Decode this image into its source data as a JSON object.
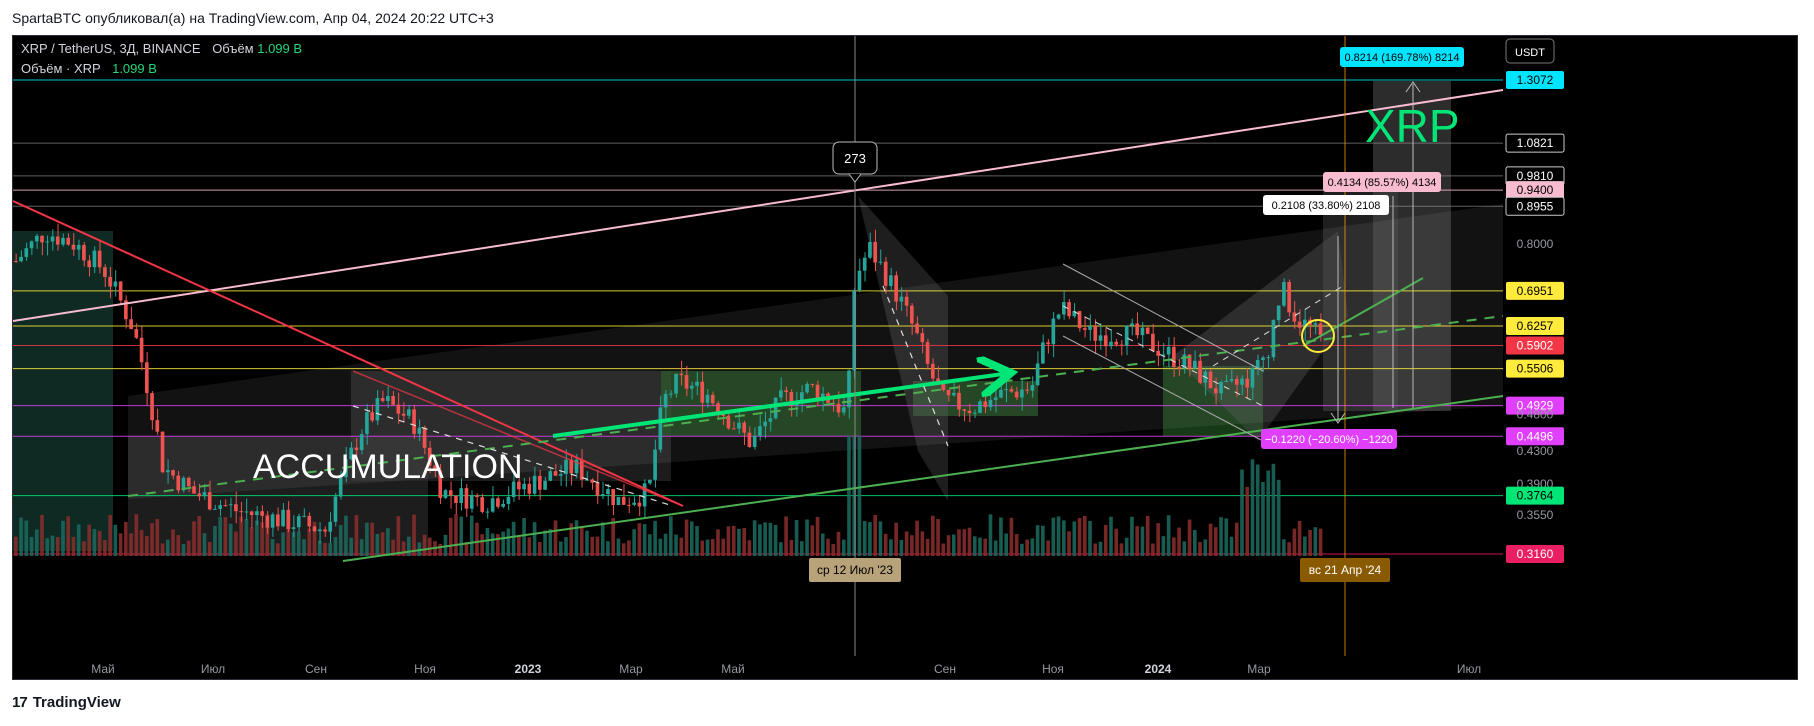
{
  "header": {
    "text": "SpartaBTC опубликовал(а) на TradingView.com, Апр 04, 2024 20:22 UTC+3"
  },
  "legend": {
    "line1_prefix": "XRP / TetherUS, 3Д, BINANCE",
    "line1_vol_label": "Объём",
    "line1_vol_value": "1.099 B",
    "line2_label": "Объём · XRP",
    "line2_value": "1.099 B"
  },
  "currency_button": "USDT",
  "footer": {
    "logo_mark": "17",
    "logo_text": "TradingView"
  },
  "annotations": {
    "accumulation": "ACCUMULATION",
    "xrp_big": "XRP",
    "peak_label": "273",
    "measure_top": "0.8214 (169.78%) 8214",
    "measure_mid": "0.4134 (85.57%) 4134",
    "measure_left": "0.2108 (33.80%) 2108",
    "measure_down": "−0.1220 (−20.60%) −1220",
    "crosshair_date": "ср 12 Июл '23",
    "current_date": "вс 21 Апр '24"
  },
  "colors": {
    "background": "#000000",
    "up": "#26a69a",
    "down": "#ef5350",
    "green_line": "#4caf50",
    "bright_green": "#00e676",
    "red_line": "#f23645",
    "pink_line": "#f8bbd0",
    "yellow": "#ffeb3b",
    "magenta": "#e040fb",
    "cyan": "#00bcd4"
  },
  "chart_data": {
    "type": "candlestick",
    "title": "XRP / TetherUS, 3Д, BINANCE",
    "xlabel": "",
    "ylabel": "",
    "y_scale": "log",
    "ylim": [
      0.316,
      1.3072
    ],
    "x_ticks": [
      "Май",
      "Июл",
      "Сен",
      "Ноя",
      "2023",
      "Мар",
      "Май",
      "Сен",
      "Ноя",
      "2024",
      "Мар",
      "Июл"
    ],
    "price_levels": [
      {
        "value": "1.3072",
        "style": "highlight",
        "color": "#00e5ff"
      },
      {
        "value": "1.0821",
        "style": "box"
      },
      {
        "value": "0.9810",
        "style": "box"
      },
      {
        "value": "0.9400",
        "style": "highlight",
        "color": "#f8bbd0"
      },
      {
        "value": "0.8955",
        "style": "box"
      },
      {
        "value": "0.8000",
        "style": "plain"
      },
      {
        "value": "0.6951",
        "style": "highlight",
        "color": "#ffeb3b"
      },
      {
        "value": "0.6257",
        "style": "highlight",
        "color": "#ffeb3b"
      },
      {
        "value": "0.5902",
        "style": "highlight",
        "color": "#f23645"
      },
      {
        "value": "0.5506",
        "style": "highlight",
        "color": "#ffeb3b"
      },
      {
        "value": "0.4929",
        "style": "highlight",
        "color": "#e040fb"
      },
      {
        "value": "0.4800",
        "style": "plain"
      },
      {
        "value": "0.4496",
        "style": "highlight",
        "color": "#e040fb"
      },
      {
        "value": "0.4300",
        "style": "plain"
      },
      {
        "value": "0.3900",
        "style": "plain"
      },
      {
        "value": "0.3764",
        "style": "highlight",
        "color": "#00e676"
      },
      {
        "value": "0.3550",
        "style": "plain"
      },
      {
        "value": "0.3160",
        "style": "highlight",
        "color": "#e91e63"
      }
    ],
    "price_path": [
      [
        0.0,
        0.76
      ],
      [
        0.02,
        0.83
      ],
      [
        0.04,
        0.8
      ],
      [
        0.06,
        0.74
      ],
      [
        0.08,
        0.62
      ],
      [
        0.1,
        0.41
      ],
      [
        0.12,
        0.38
      ],
      [
        0.15,
        0.36
      ],
      [
        0.18,
        0.35
      ],
      [
        0.21,
        0.34
      ],
      [
        0.235,
        0.46
      ],
      [
        0.25,
        0.5
      ],
      [
        0.27,
        0.47
      ],
      [
        0.29,
        0.38
      ],
      [
        0.32,
        0.37
      ],
      [
        0.35,
        0.39
      ],
      [
        0.38,
        0.41
      ],
      [
        0.41,
        0.37
      ],
      [
        0.43,
        0.38
      ],
      [
        0.44,
        0.5
      ],
      [
        0.45,
        0.53
      ],
      [
        0.47,
        0.51
      ],
      [
        0.49,
        0.46
      ],
      [
        0.5,
        0.44
      ],
      [
        0.52,
        0.5
      ],
      [
        0.54,
        0.52
      ],
      [
        0.555,
        0.5
      ],
      [
        0.565,
        0.48
      ],
      [
        0.57,
        0.72
      ],
      [
        0.58,
        0.79
      ],
      [
        0.6,
        0.68
      ],
      [
        0.61,
        0.62
      ],
      [
        0.62,
        0.55
      ],
      [
        0.63,
        0.5
      ],
      [
        0.65,
        0.49
      ],
      [
        0.67,
        0.51
      ],
      [
        0.69,
        0.52
      ],
      [
        0.7,
        0.6
      ],
      [
        0.71,
        0.66
      ],
      [
        0.73,
        0.61
      ],
      [
        0.76,
        0.61
      ],
      [
        0.78,
        0.58
      ],
      [
        0.8,
        0.55
      ],
      [
        0.82,
        0.51
      ],
      [
        0.84,
        0.54
      ],
      [
        0.85,
        0.58
      ],
      [
        0.86,
        0.7
      ],
      [
        0.87,
        0.64
      ],
      [
        0.88,
        0.62
      ],
      [
        0.89,
        0.59
      ]
    ]
  }
}
